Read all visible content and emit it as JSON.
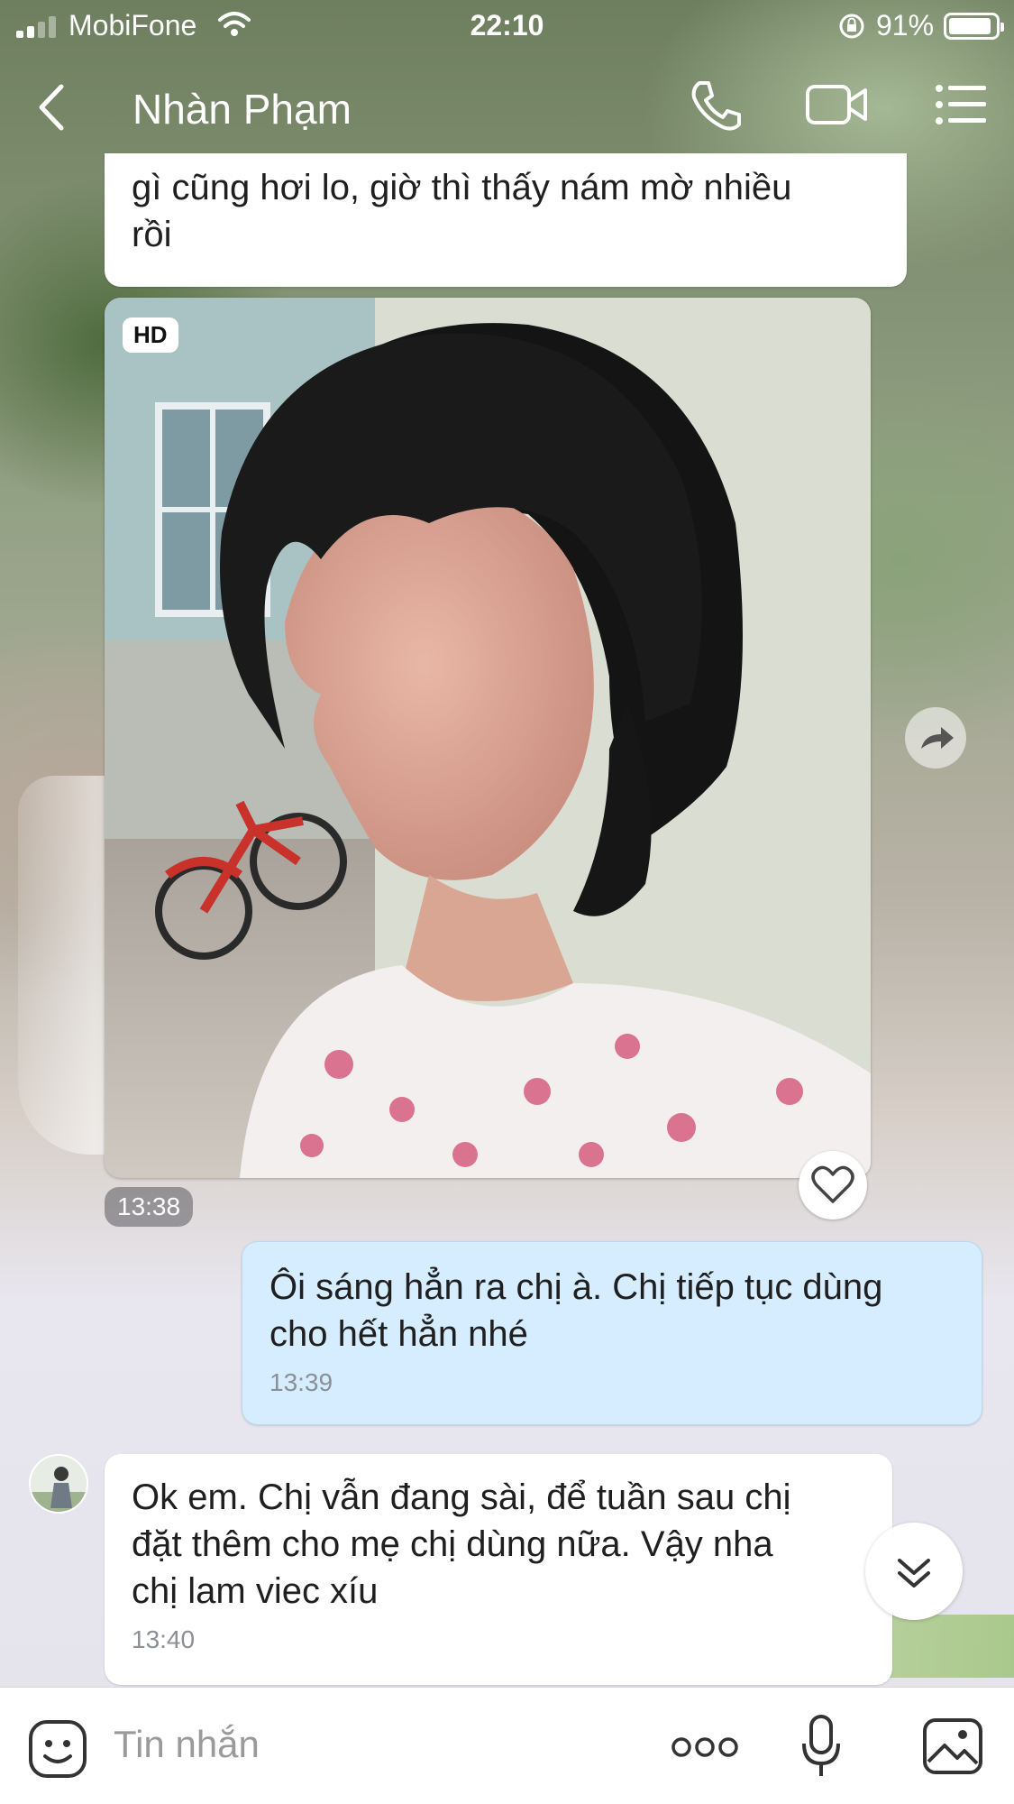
{
  "status_bar": {
    "carrier": "MobiFone",
    "time": "22:10",
    "battery_percent": "91%",
    "battery_level": 0.91,
    "signal_bars": 2
  },
  "header": {
    "contact_name": "Nhàn Phạm",
    "back_icon": "chevron-left-icon",
    "call_icon": "phone-icon",
    "video_icon": "video-camera-icon",
    "menu_icon": "list-icon"
  },
  "messages": [
    {
      "direction": "incoming",
      "text_line_1": "gì cũng hơi lo, giờ thì thấy nám mờ nhiều",
      "text_line_2": "rồi"
    },
    {
      "direction": "incoming",
      "type": "photo",
      "badge": "HD",
      "time": "13:38"
    },
    {
      "direction": "outgoing",
      "text_line_1": "Ôi sáng hẳn ra chị à. Chị tiếp tục dùng",
      "text_line_2": "cho hết hẳn nhé",
      "time": "13:39"
    },
    {
      "direction": "incoming",
      "text_line_1": "Ok em. Chị vẫn đang sài, để tuần sau chị",
      "text_line_2": "đặt thêm cho mẹ chị dùng nữa. Vậy nha",
      "text_line_3": "chị lam viec xíu",
      "time": "13:40"
    }
  ],
  "input_bar": {
    "placeholder": "Tin nhắn",
    "sticker_icon": "emoji-icon",
    "more_icon": "more-dots-icon",
    "mic_icon": "microphone-icon",
    "image_icon": "image-icon"
  },
  "colors": {
    "outgoing_bubble": "#d6ecff",
    "incoming_bubble": "#ffffff",
    "time_text": "#8b8f96"
  }
}
